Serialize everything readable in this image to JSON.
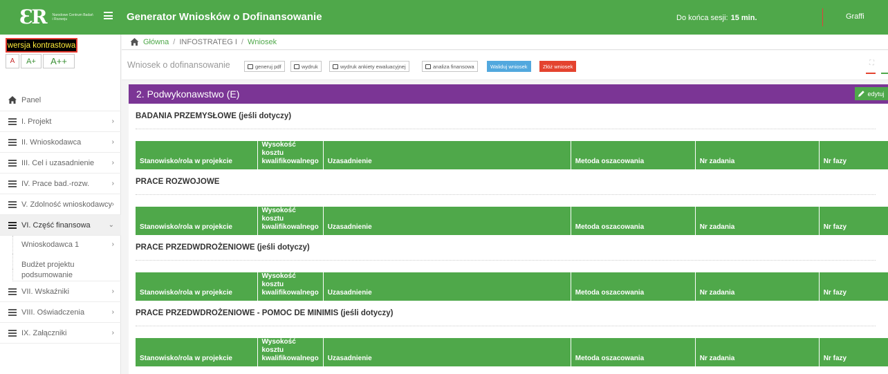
{
  "header": {
    "logo_mark": "ƐR",
    "logo_text": "Narodowe Centrum Badań i Rozwoju",
    "app_title": "Generator Wniosków o Dofinansowanie",
    "session_label": "Do końca sesji:",
    "session_value": "15 min.",
    "user": "Graffi",
    "brand_color": "#4fa84a"
  },
  "sidebar": {
    "contrast_label": "wersja kontrastowa",
    "font_small": "A",
    "font_medium": "A+",
    "font_large": "A++",
    "panel_label": "Panel",
    "items": [
      {
        "label": "I. Projekt"
      },
      {
        "label": "II. Wnioskodawca"
      },
      {
        "label": "III. Cel i uzasadnienie"
      },
      {
        "label": "IV. Prace bad.-rozw."
      },
      {
        "label": "V. Zdolność wnioskodawcy"
      },
      {
        "label": "VI. Część finansowa"
      }
    ],
    "sub_items": [
      {
        "label": "Wnioskodawca 1"
      },
      {
        "label": "Budżet projektu"
      },
      {
        "label": "podsumowanie"
      }
    ],
    "items_after": [
      {
        "label": "VII. Wskaźniki"
      },
      {
        "label": "VIII. Oświadczenia"
      },
      {
        "label": "IX. Załączniki"
      }
    ]
  },
  "breadcrumb": {
    "home": "Główna",
    "middle": "INFOSTRATEG I",
    "current": "Wniosek"
  },
  "toolbar": {
    "heading": "Wniosek o dofinansowanie",
    "btn_pdf": "generuj pdf",
    "btn_print": "wydruk",
    "btn_print_survey": "wydruk ankiety ewaluacyjnej",
    "btn_analysis": "analiza finansowa",
    "btn_validate": "Waliduj wniosek",
    "btn_submit": "Złóż wniosek"
  },
  "panel": {
    "title": "2. Podwykonawstwo (E)",
    "edit_label": "edytuj",
    "accent_color": "#7b3595",
    "columns": [
      "Stanowisko/rola w projekcie",
      "Wysokość kosztu kwalifikowalnego",
      "Uzasadnienie",
      "Metoda oszacowania",
      "Nr zadania",
      "Nr fazy"
    ],
    "sections": [
      {
        "title": "BADANIA PRZEMYSŁOWE (jeśli dotyczy)"
      },
      {
        "title": "PRACE ROZWOJOWE"
      },
      {
        "title": "PRACE PRZEDWDROŻENIOWE (jeśli dotyczy)"
      },
      {
        "title": "PRACE PRZEDWDROŻENIOWE - POMOC DE MINIMIS (jeśli dotyczy)"
      }
    ]
  }
}
